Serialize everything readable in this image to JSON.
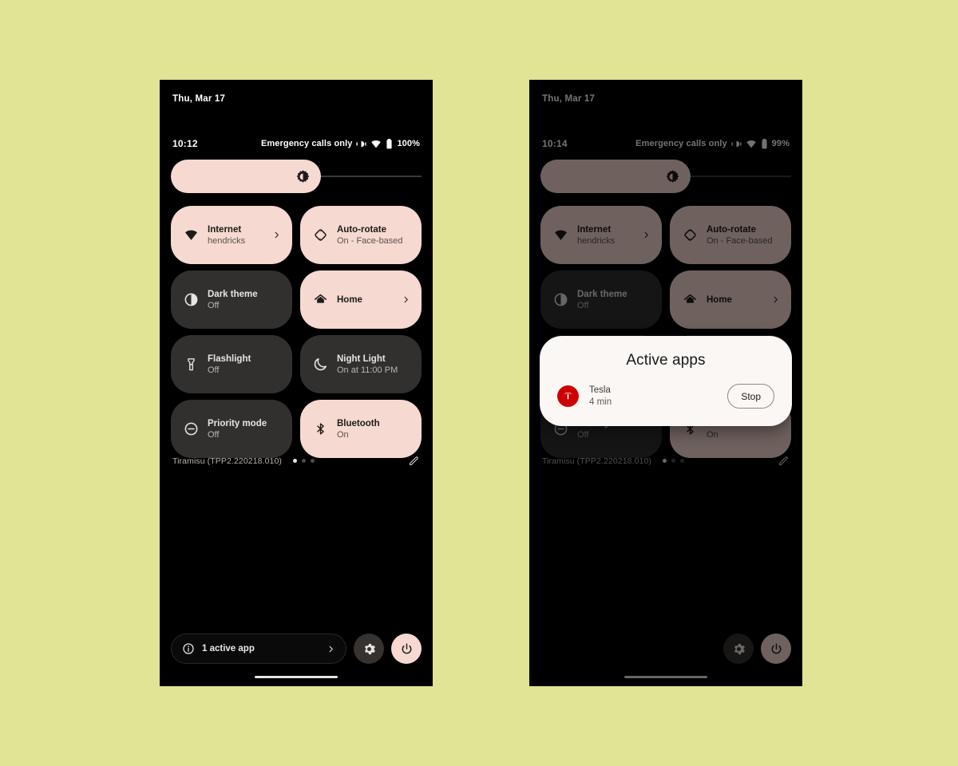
{
  "theme": {
    "page_background": "#e0e494",
    "phone_background": "#000000",
    "tile_on_color": "#f6d9d0",
    "tile_off_color": "#32302f",
    "dialog_background": "#faf7f4",
    "tesla_red": "#cc0000"
  },
  "phones": [
    {
      "id": "left",
      "date": "Thu, Mar 17",
      "status": {
        "clock": "10:12",
        "carrier": "Emergency calls only",
        "battery": "100%",
        "icons": [
          "vibrate-icon",
          "wifi-icon",
          "battery-icon"
        ]
      },
      "brightness": {
        "icon": "brightness-icon",
        "level": 55
      },
      "tiles": [
        {
          "title": "Internet",
          "subtitle": "hendricks",
          "state": "on",
          "icon": "wifi-icon",
          "chevron": true,
          "layout": "two-line"
        },
        {
          "title": "Auto-rotate",
          "subtitle": "On - Face-based",
          "state": "on",
          "icon": "auto-rotate-icon",
          "chevron": false,
          "layout": "two-line"
        },
        {
          "title": "Dark theme",
          "subtitle": "Off",
          "state": "off",
          "icon": "dark-theme-icon",
          "chevron": false,
          "layout": "two-line"
        },
        {
          "title": "Home",
          "subtitle": "",
          "state": "on",
          "icon": "home-icon",
          "chevron": true,
          "layout": "one-line"
        },
        {
          "title": "Flashlight",
          "subtitle": "Off",
          "state": "off",
          "icon": "flashlight-icon",
          "chevron": false,
          "layout": "two-line"
        },
        {
          "title": "Night Light",
          "subtitle": "On at 11:00 PM",
          "state": "off",
          "icon": "moon-icon",
          "chevron": false,
          "layout": "two-line"
        },
        {
          "title": "Priority mode",
          "subtitle": "Off",
          "state": "off",
          "icon": "do-not-disturb-icon",
          "chevron": false,
          "layout": "two-line"
        },
        {
          "title": "Bluetooth",
          "subtitle": "On",
          "state": "on",
          "icon": "bluetooth-icon",
          "chevron": false,
          "layout": "two-line"
        }
      ],
      "build": {
        "label": "Tiramisu (TPP2.220218.010)",
        "pages": 3,
        "active_page": 1,
        "edit_icon": "pencil-icon"
      },
      "bottom_bar": {
        "active_chip": {
          "icon": "info-icon",
          "label": "1 active app",
          "chevron_icon": "chevron-right-icon"
        },
        "settings_icon": "gear-icon",
        "power_icon": "power-icon"
      },
      "dialog": null
    },
    {
      "id": "right",
      "date": "Thu, Mar 17",
      "status": {
        "clock": "10:14",
        "carrier": "Emergency calls only",
        "battery": "99%",
        "icons": [
          "vibrate-icon",
          "wifi-icon",
          "battery-icon"
        ]
      },
      "brightness": {
        "icon": "brightness-icon",
        "level": 55
      },
      "tiles": [
        {
          "title": "Internet",
          "subtitle": "hendricks",
          "state": "on",
          "icon": "wifi-icon",
          "chevron": true,
          "layout": "two-line"
        },
        {
          "title": "Auto-rotate",
          "subtitle": "On - Face-based",
          "state": "on",
          "icon": "auto-rotate-icon",
          "chevron": false,
          "layout": "two-line"
        },
        {
          "title": "Dark theme",
          "subtitle": "Off",
          "state": "off",
          "icon": "dark-theme-icon",
          "chevron": false,
          "layout": "two-line"
        },
        {
          "title": "Home",
          "subtitle": "",
          "state": "on",
          "icon": "home-icon",
          "chevron": true,
          "layout": "one-line"
        },
        {
          "title": "Flashlight",
          "subtitle": "Off",
          "state": "off",
          "icon": "flashlight-icon",
          "chevron": false,
          "layout": "two-line"
        },
        {
          "title": "Night Light",
          "subtitle": "On at 11:00 PM",
          "state": "off",
          "icon": "moon-icon",
          "chevron": false,
          "layout": "two-line"
        },
        {
          "title": "Priority mode",
          "subtitle": "Off",
          "state": "off",
          "icon": "do-not-disturb-icon",
          "chevron": false,
          "layout": "two-line"
        },
        {
          "title": "Bluetooth",
          "subtitle": "On",
          "state": "on",
          "icon": "bluetooth-icon",
          "chevron": false,
          "layout": "two-line"
        }
      ],
      "build": {
        "label": "Tiramisu (TPP2.220218.010)",
        "pages": 3,
        "active_page": 1,
        "edit_icon": "pencil-icon"
      },
      "bottom_bar": {
        "active_chip": null,
        "settings_icon": "gear-icon",
        "power_icon": "power-icon"
      },
      "dialog": {
        "title": "Active apps",
        "apps": [
          {
            "name": "Tesla",
            "duration": "4 min",
            "icon": "tesla-icon",
            "action_label": "Stop"
          }
        ]
      }
    }
  ]
}
